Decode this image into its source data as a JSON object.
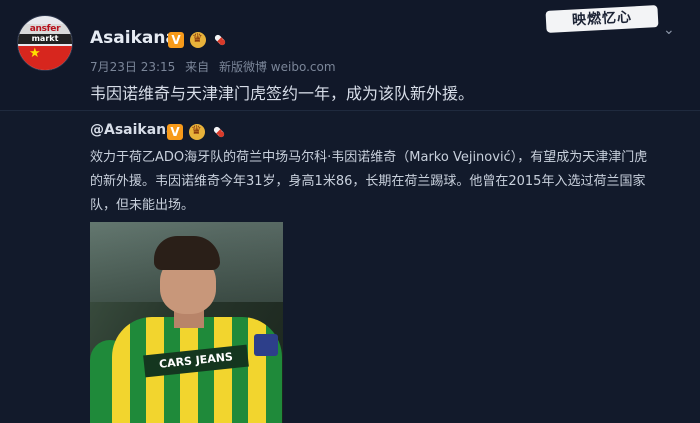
{
  "post": {
    "username": "Asaikana",
    "meta": {
      "date_time": "7月23日 23:15",
      "via": "来自",
      "client": "新版微博 weibo.com"
    },
    "text": "韦因诺维奇与天津津门虎签约一年，成为该队新外援。"
  },
  "avatar": {
    "line1": "ansfer",
    "line2": "markt"
  },
  "watermark": {
    "text": "映燃忆心"
  },
  "repost": {
    "author": "@Asaikana",
    "body": "效力于荷乙ADO海牙队的荷兰中场马尔科·韦因诺维奇（Marko Vejinović），有望成为天津津门虎的新外援。韦因诺维奇今年31岁，身高1米86，长期在荷兰踢球。他曾在2015年入选过荷兰国家队，但未能出场。",
    "photo_text": "CARS JEANS"
  },
  "icons": {
    "verified": "verified-v-icon",
    "crown": "crown-icon",
    "pill": "pill-icon",
    "caret": "chevron-down-icon"
  },
  "colors": {
    "background": "#111829",
    "verified": "#f79a1a",
    "text": "#d7dde8",
    "meta": "#7b8699"
  }
}
